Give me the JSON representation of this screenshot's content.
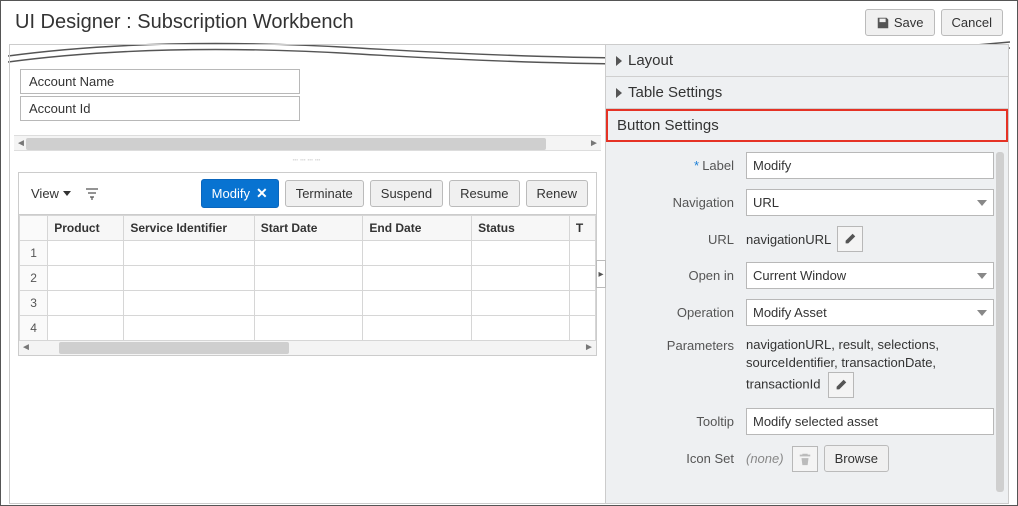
{
  "header": {
    "title": "UI Designer : Subscription Workbench",
    "save_label": "Save",
    "cancel_label": "Cancel"
  },
  "form": {
    "field1": "Account Name",
    "field2": "Account Id"
  },
  "toolbar": {
    "view_label": "View",
    "buttons": {
      "modify": "Modify",
      "terminate": "Terminate",
      "suspend": "Suspend",
      "resume": "Resume",
      "renew": "Renew"
    }
  },
  "grid": {
    "columns": {
      "c1": "Product",
      "c2": "Service Identifier",
      "c3": "Start Date",
      "c4": "End Date",
      "c5": "Status",
      "c6": "T"
    },
    "rows": {
      "r1": "1",
      "r2": "2",
      "r3": "3",
      "r4": "4"
    }
  },
  "right": {
    "layout_label": "Layout",
    "table_settings_label": "Table Settings",
    "button_settings_label": "Button Settings",
    "fields": {
      "label_lbl": "Label",
      "label_val": "Modify",
      "navigation_lbl": "Navigation",
      "navigation_val": "URL",
      "url_lbl": "URL",
      "url_val": "navigationURL",
      "openin_lbl": "Open in",
      "openin_val": "Current Window",
      "operation_lbl": "Operation",
      "operation_val": "Modify Asset",
      "parameters_lbl": "Parameters",
      "parameters_val": "navigationURL, result, selections, sourceIdentifier, transactionDate, transactionId",
      "tooltip_lbl": "Tooltip",
      "tooltip_val": "Modify selected asset",
      "iconset_lbl": "Icon Set",
      "iconset_none": "(none)",
      "iconset_browse": "Browse"
    }
  }
}
